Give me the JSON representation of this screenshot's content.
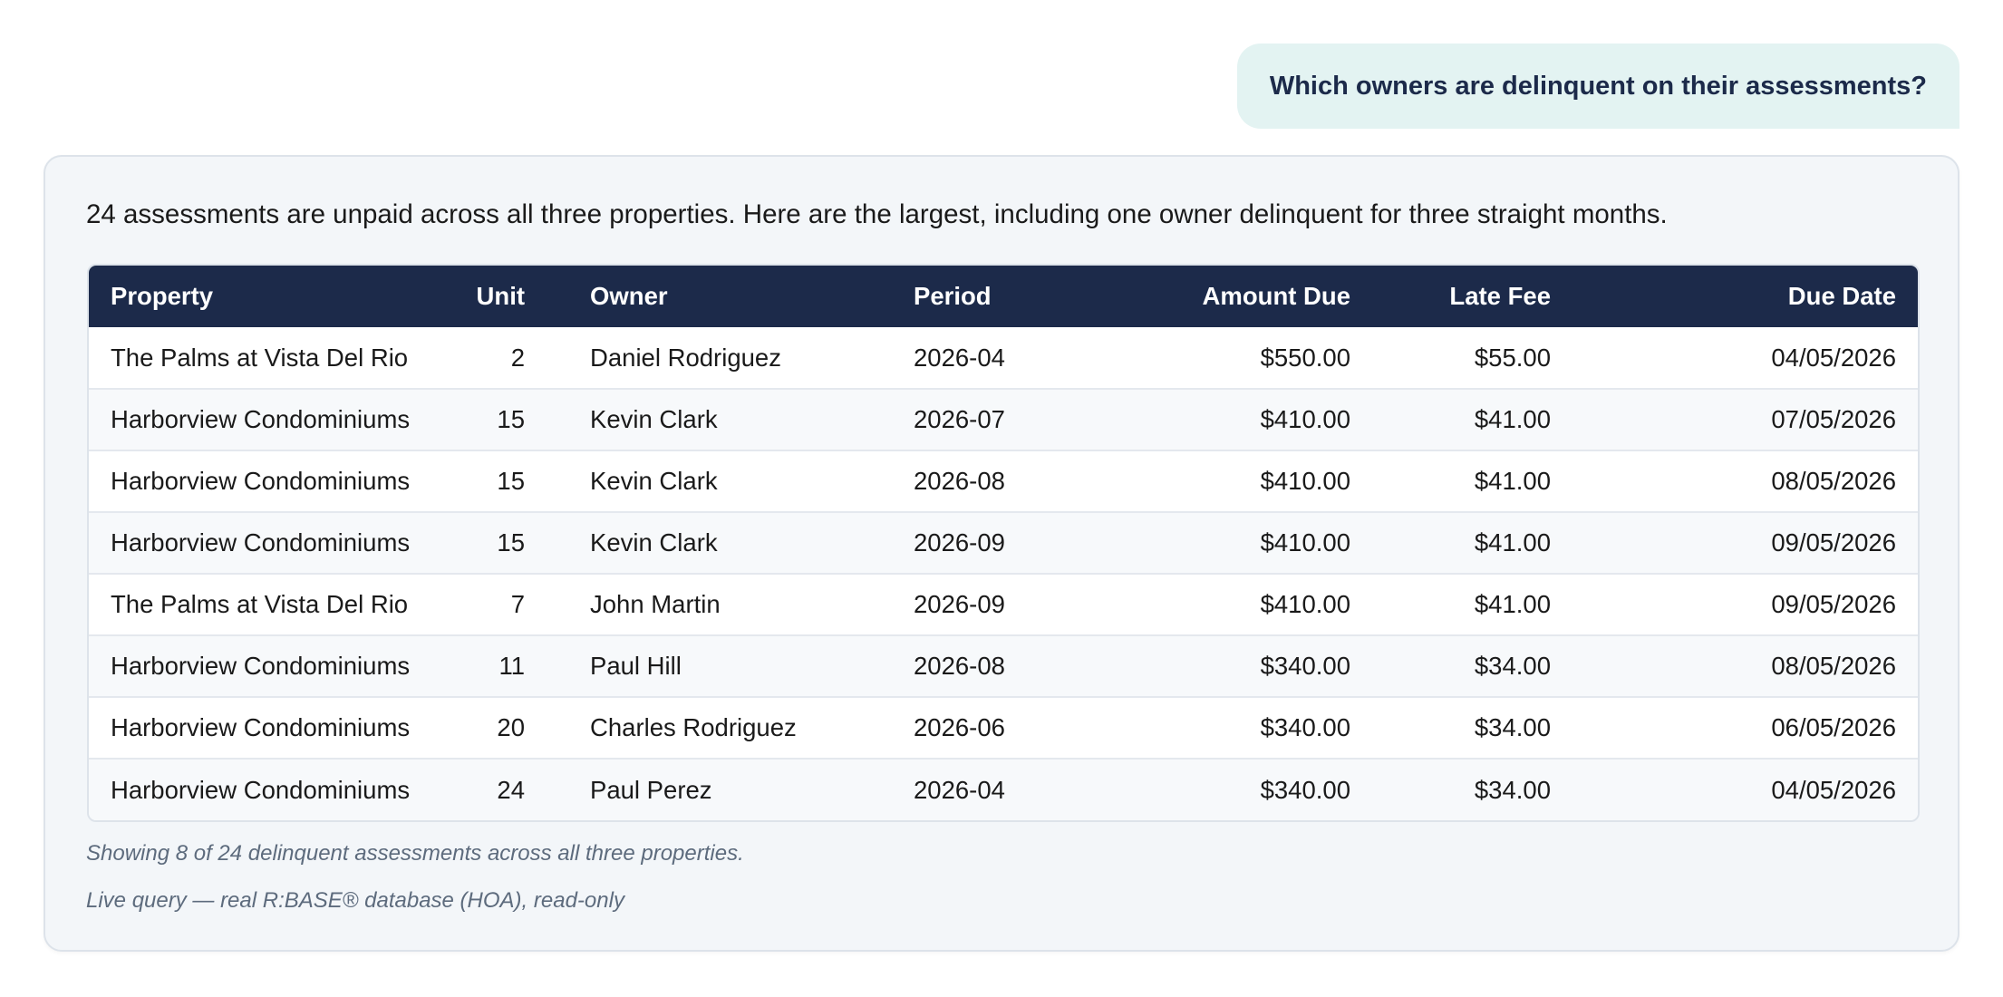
{
  "user_message": "Which owners are delinquent on their assessments?",
  "answer": {
    "intro": "24 assessments are unpaid across all three properties. Here are the largest, including one owner delinquent for three straight months.",
    "table": {
      "headers": [
        "Property",
        "Unit",
        "Owner",
        "Period",
        "Amount Due",
        "Late Fee",
        "Due Date"
      ],
      "rows": [
        [
          "The Palms at Vista Del Rio",
          "2",
          "Daniel Rodriguez",
          "2026-04",
          "$550.00",
          "$55.00",
          "04/05/2026"
        ],
        [
          "Harborview Condominiums",
          "15",
          "Kevin Clark",
          "2026-07",
          "$410.00",
          "$41.00",
          "07/05/2026"
        ],
        [
          "Harborview Condominiums",
          "15",
          "Kevin Clark",
          "2026-08",
          "$410.00",
          "$41.00",
          "08/05/2026"
        ],
        [
          "Harborview Condominiums",
          "15",
          "Kevin Clark",
          "2026-09",
          "$410.00",
          "$41.00",
          "09/05/2026"
        ],
        [
          "The Palms at Vista Del Rio",
          "7",
          "John Martin",
          "2026-09",
          "$410.00",
          "$41.00",
          "09/05/2026"
        ],
        [
          "Harborview Condominiums",
          "11",
          "Paul Hill",
          "2026-08",
          "$340.00",
          "$34.00",
          "08/05/2026"
        ],
        [
          "Harborview Condominiums",
          "20",
          "Charles Rodriguez",
          "2026-06",
          "$340.00",
          "$34.00",
          "06/05/2026"
        ],
        [
          "Harborview Condominiums",
          "24",
          "Paul Perez",
          "2026-04",
          "$340.00",
          "$34.00",
          "04/05/2026"
        ]
      ]
    },
    "footnote_summary": "Showing 8 of 24 delinquent assessments across all three properties.",
    "footnote_source": "Live query — real R:BASE® database (HOA), read-only"
  },
  "colors": {
    "header_bg": "#1c2a4a",
    "user_bubble_bg": "#e3f3f2",
    "card_bg": "#f3f6f9",
    "footnote_text": "#5d6b7d"
  }
}
